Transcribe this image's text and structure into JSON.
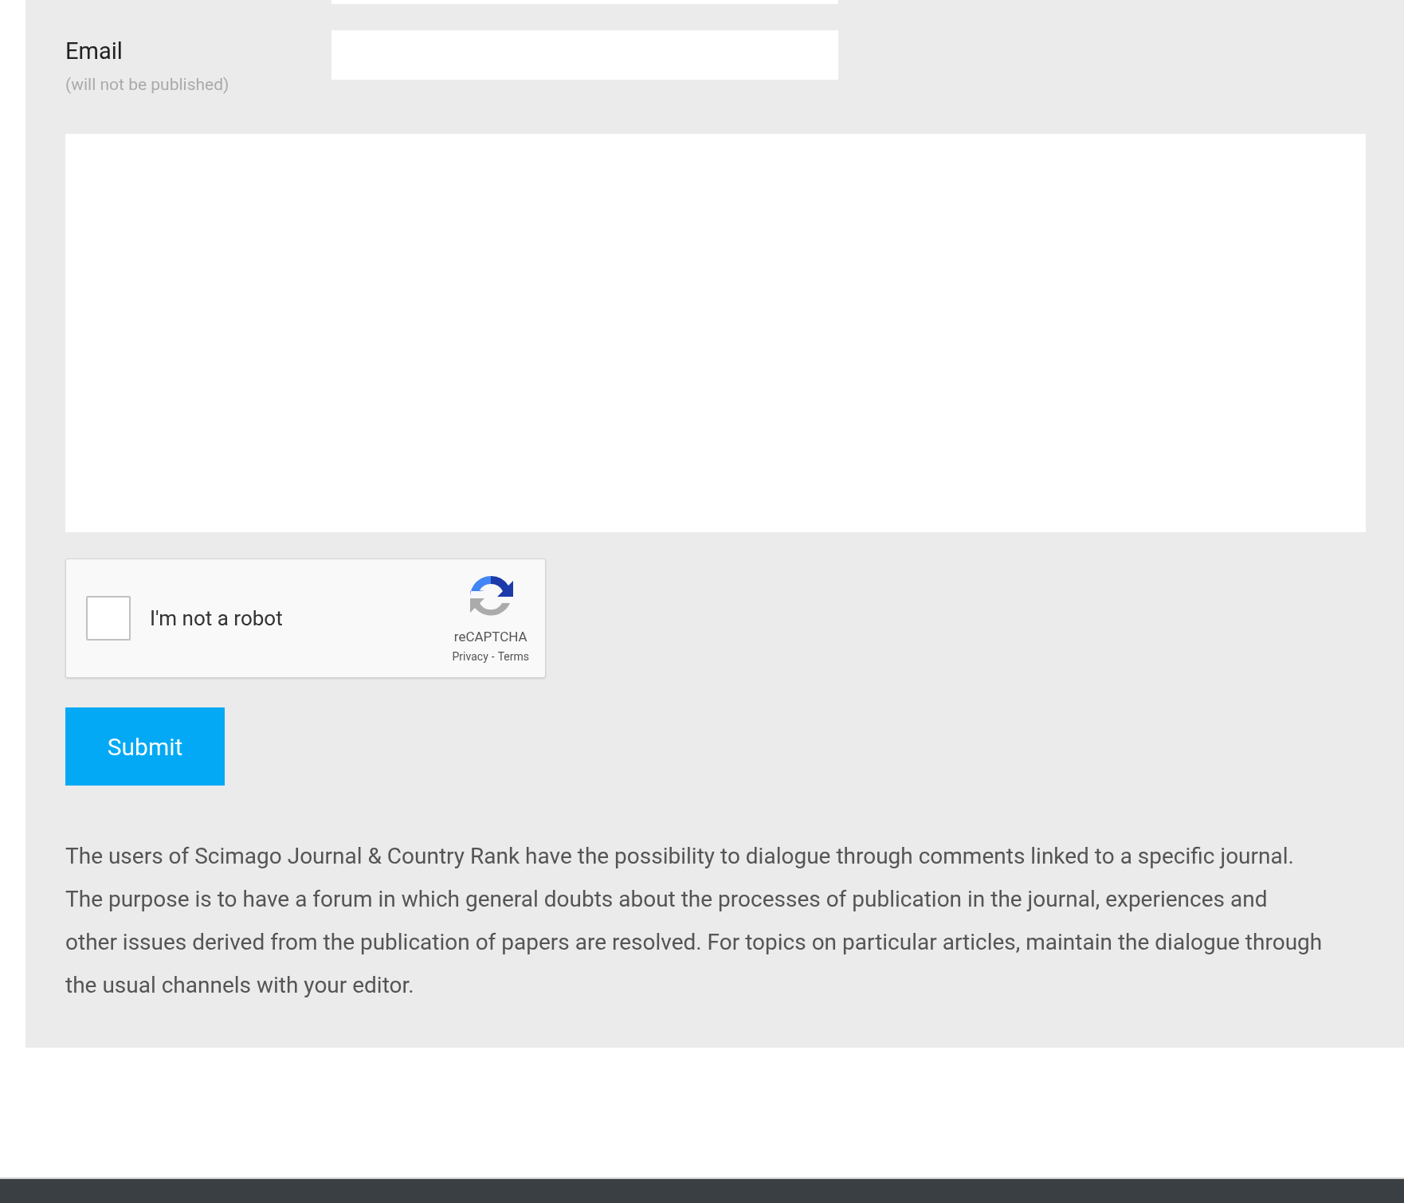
{
  "email": {
    "label": "Email",
    "note": "(will not be published)"
  },
  "captcha": {
    "label": "I'm not a robot",
    "checked": false,
    "brand": "reCAPTCHA",
    "links": [
      "Privacy",
      "Terms"
    ],
    "separator": "-"
  },
  "submit": "Submit",
  "info": "The users of Scimago Journal & Country Rank have the possibility to dialogue through comments linked to a specific journal. The purpose is to have a forum in which general doubts about the processes of publication in the journal, experiences and other issues derived from the publication of papers are resolved. For topics on particular articles, maintain the dialogue through the usual channels with your editor."
}
